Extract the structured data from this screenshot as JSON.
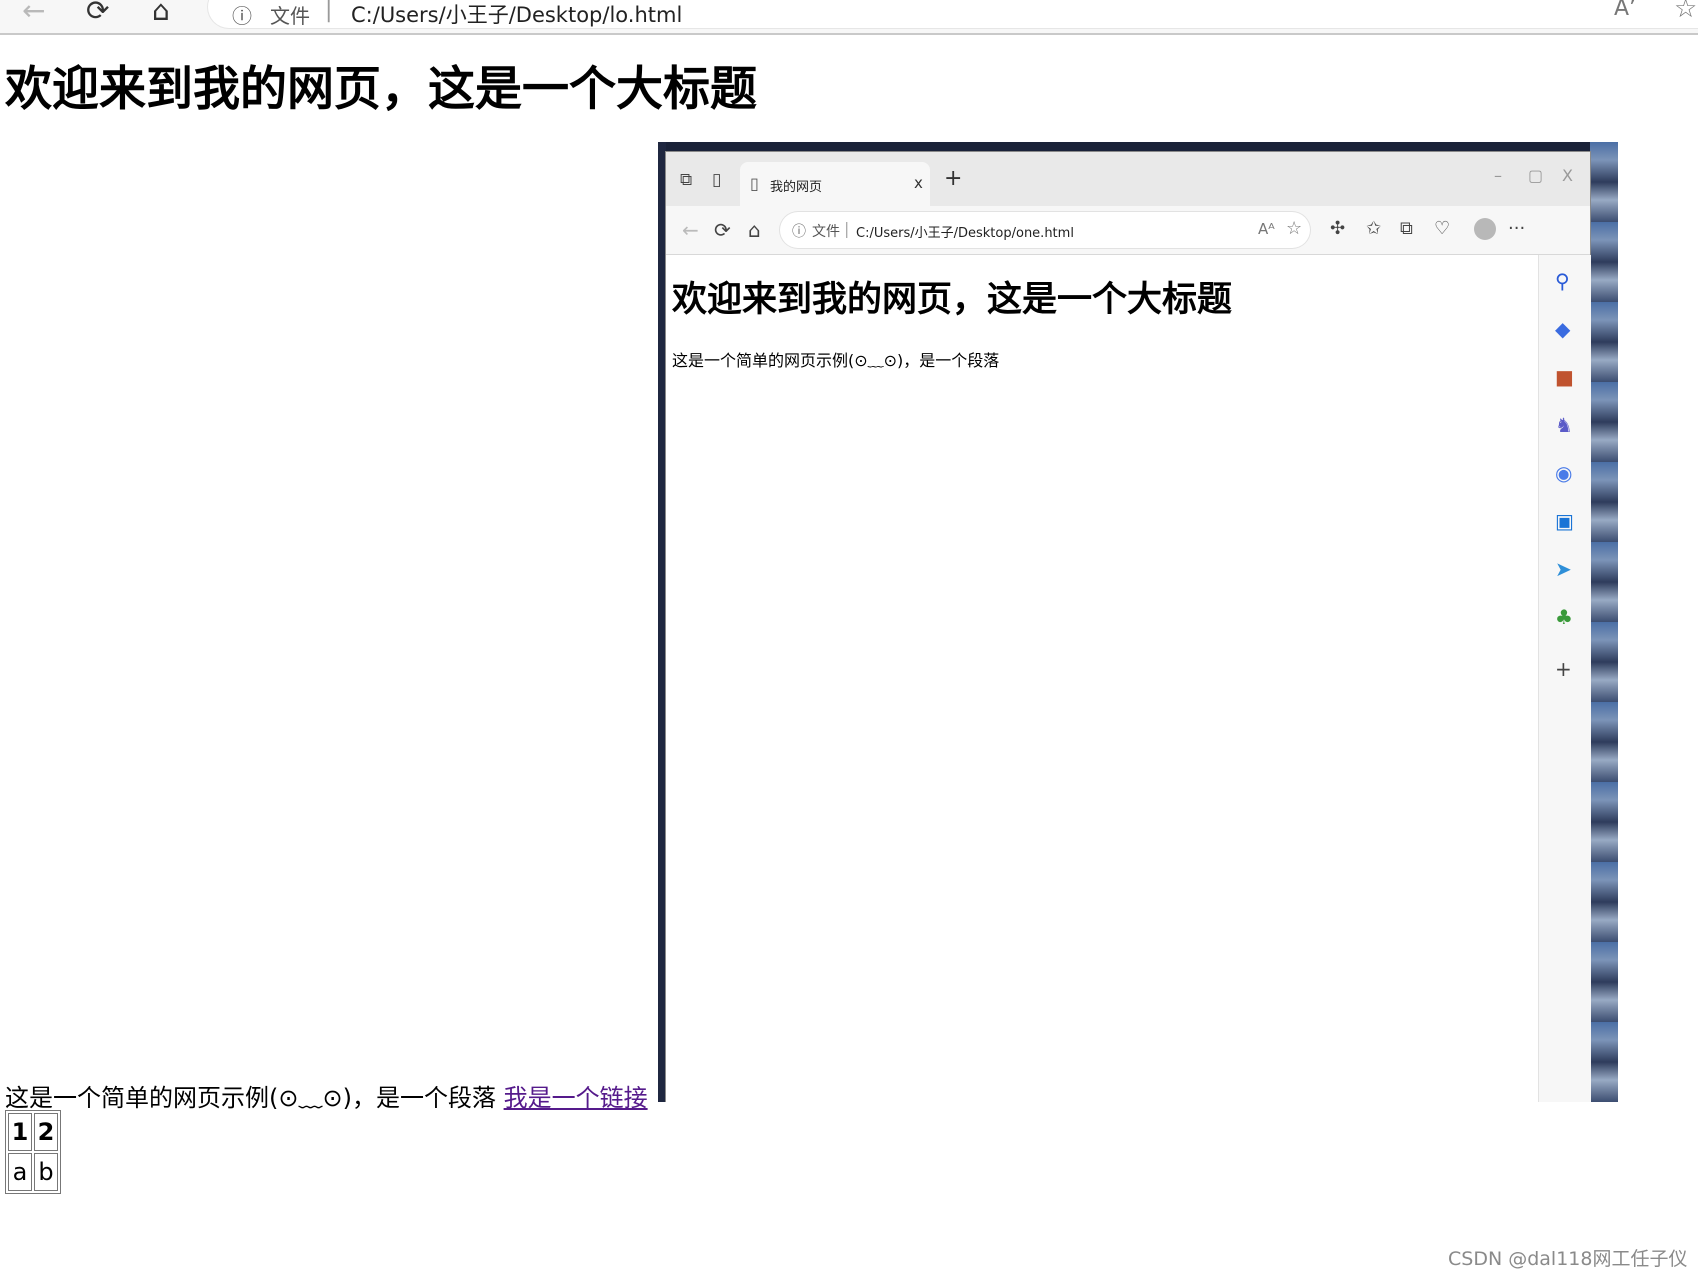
{
  "outer_browser": {
    "back_icon": "←",
    "refresh_icon": "⟳",
    "home_icon": "⌂",
    "info_icon": "ⓘ",
    "address_label": "文件",
    "address_separator": "|",
    "url": "C:/Users/小王子/Desktop/lo.html",
    "read_aloud_icon": "Aʼ",
    "favorite_icon": "☆"
  },
  "page": {
    "title": "欢迎来到我的网页，这是一个大标题",
    "paragraph": "这是一个简单的网页示例(⊙﹏⊙)，是一个段落",
    "link_text": "我是一个链接"
  },
  "embedded_screenshot": {
    "tab_title": "我的网页",
    "tab_close": "x",
    "new_tab": "+",
    "window_controls": [
      "–",
      "▢",
      "X"
    ],
    "address_label": "文件",
    "url": "C:/Users/小王子/Desktop/one.html",
    "more_icon": "···",
    "heading": "欢迎来到我的网页，这是一个大标题",
    "paragraph": "这是一个简单的网页示例(⊙﹏⊙)，是一个段落",
    "sidebar_icons": [
      "search-icon",
      "tag-icon",
      "briefcase-icon",
      "chess-icon",
      "office-icon",
      "outlook-icon",
      "send-icon",
      "tree-icon",
      "add-icon"
    ],
    "sidebar_add": "+"
  },
  "table": {
    "rows": [
      [
        "1",
        "2"
      ],
      [
        "a",
        "b"
      ]
    ]
  },
  "watermark": "CSDN @dal118网工任子仪"
}
